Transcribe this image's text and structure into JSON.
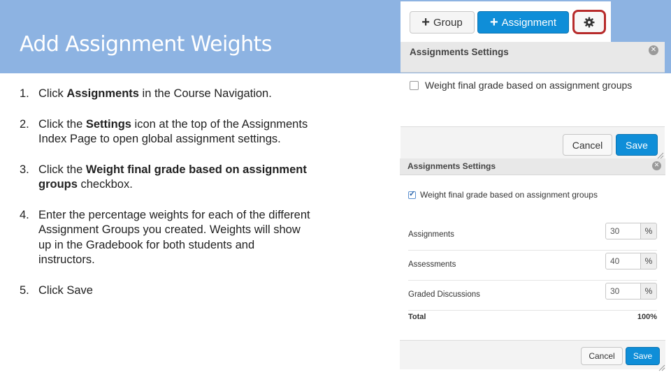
{
  "slide": {
    "title": "Add Assignment Weights",
    "steps": [
      {
        "num": "1.",
        "pre": "Click ",
        "bold": "Assignments",
        "post": " in the Course Navigation."
      },
      {
        "num": "2.",
        "pre": "Click the ",
        "bold": "Settings",
        "post": " icon at the top of the Assignments Index Page to open global assignment settings."
      },
      {
        "num": "3.",
        "pre": "Click the ",
        "bold": "Weight final grade based on assignment groups",
        "post": " checkbox."
      },
      {
        "num": "4.",
        "pre": "Enter the percentage weights for each of the different Assignment Groups you created. Weights will show up in the Gradebook for both students and instructors.",
        "bold": "",
        "post": ""
      },
      {
        "num": "5.",
        "pre": "Click Save",
        "bold": "",
        "post": ""
      }
    ]
  },
  "toolbar": {
    "group_label": "Group",
    "assignment_label": "Assignment",
    "settings_icon": "gear-icon",
    "highlight_color": "#b72b2b"
  },
  "dialog1": {
    "title": "Assignments Settings",
    "checkbox_label": "Weight final grade based on assignment groups",
    "checked": false,
    "cancel_label": "Cancel",
    "save_label": "Save"
  },
  "dialog2": {
    "title": "Assignments Settings",
    "checkbox_label": "Weight final grade based on assignment groups",
    "checked": true,
    "groups": [
      {
        "name": "Assignments",
        "weight": "30",
        "unit": "%"
      },
      {
        "name": "Assessments",
        "weight": "40",
        "unit": "%"
      },
      {
        "name": "Graded Discussions",
        "weight": "30",
        "unit": "%"
      }
    ],
    "total_label": "Total",
    "total_value": "100%",
    "cancel_label": "Cancel",
    "save_label": "Save"
  },
  "colors": {
    "header_band": "#8db3e2",
    "primary_button": "#0f8ed8"
  }
}
